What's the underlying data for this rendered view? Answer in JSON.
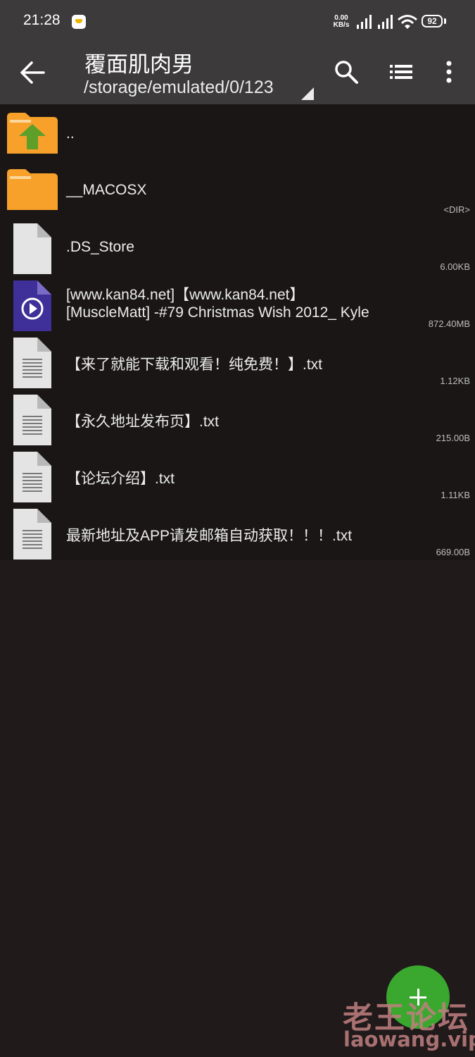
{
  "status_bar": {
    "time": "21:28",
    "speed_value": "0.00",
    "speed_unit": "KB/s",
    "battery": "92"
  },
  "app_bar": {
    "title": "覆面肌肉男",
    "path": "/storage/emulated/0/123"
  },
  "files": [
    {
      "type": "folder-up",
      "icon": "folder-up-icon",
      "lines": [
        ".."
      ],
      "meta": ""
    },
    {
      "type": "folder",
      "icon": "folder-icon",
      "lines": [
        "__MACOSX"
      ],
      "meta": "<DIR>"
    },
    {
      "type": "file",
      "icon": "file-icon",
      "lines": [
        ".DS_Store"
      ],
      "meta": "6.00KB"
    },
    {
      "type": "video",
      "icon": "video-file-icon",
      "lines": [
        "[www.kan84.net]【www.kan84.net】",
        "[MuscleMatt] -#79 Christmas Wish 2012_ Kyle"
      ],
      "meta": "872.40MB"
    },
    {
      "type": "text",
      "icon": "text-file-icon",
      "lines": [
        "【来了就能下载和观看！纯免费！】.txt"
      ],
      "meta": "1.12KB"
    },
    {
      "type": "text",
      "icon": "text-file-icon",
      "lines": [
        "【永久地址发布页】.txt"
      ],
      "meta": "215.00B"
    },
    {
      "type": "text",
      "icon": "text-file-icon",
      "lines": [
        "【论坛介绍】.txt"
      ],
      "meta": "1.11KB"
    },
    {
      "type": "text",
      "icon": "text-file-icon",
      "lines": [
        "最新地址及APP请发邮箱自动获取！！！.txt"
      ],
      "meta": "669.00B"
    }
  ],
  "watermark": {
    "line1": "老王论坛",
    "line2": "laowang.vip"
  },
  "colors": {
    "folder": "#f7a12a",
    "folder_tab": "#fcd79b",
    "arrow": "#5e9f2a",
    "file_page": "#e4e4e4",
    "video": "#3f2f98",
    "fab": "#3aa72f",
    "background": "#201a1b",
    "appbar": "#3c3a3a"
  }
}
